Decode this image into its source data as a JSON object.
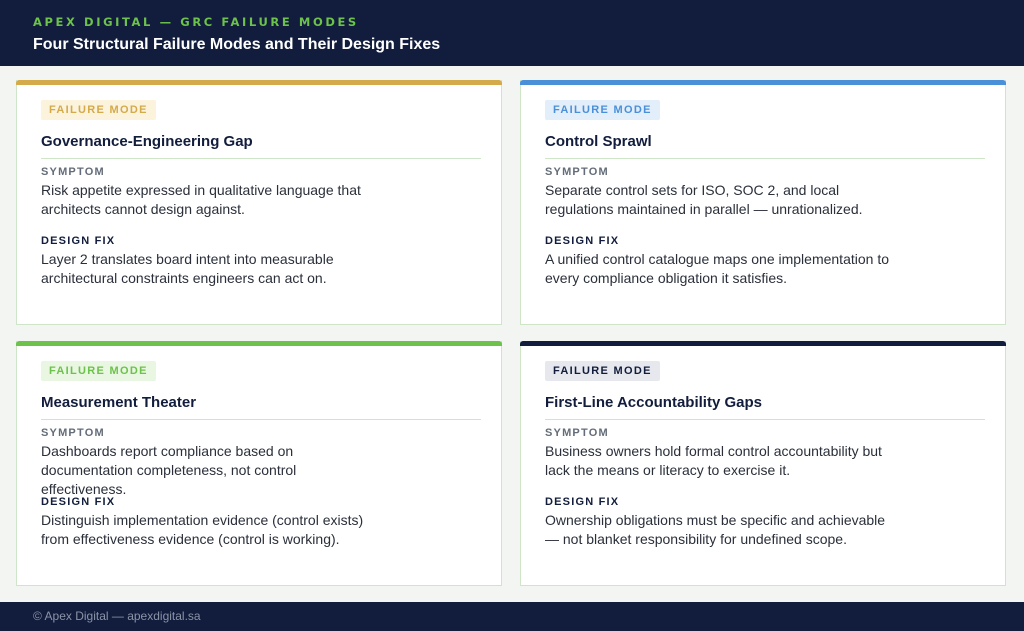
{
  "header": {
    "eyebrow": "APEX DIGITAL — GRC FAILURE MODES",
    "title": "Four Structural Failure Modes and Their Design Fixes"
  },
  "colors": {
    "gold": "#d4aa4a",
    "blue": "#4a90d9",
    "green": "#6cc24a",
    "navy": "#121d3d"
  },
  "cards": [
    {
      "tag": "FAILURE MODE",
      "title": "Governance-Engineering Gap",
      "symptom_label": "SYMPTOM",
      "symptom": "Risk appetite expressed in qualitative language that architects cannot design against.",
      "fix_label": "DESIGN FIX",
      "fix": "Layer 2 translates board intent into measurable architectural constraints engineers can act on."
    },
    {
      "tag": "FAILURE MODE",
      "title": "Control Sprawl",
      "symptom_label": "SYMPTOM",
      "symptom": "Separate control sets for ISO, SOC 2, and local regulations maintained in parallel — unrationalized.",
      "fix_label": "DESIGN FIX",
      "fix": "A unified control catalogue maps one implementation to every compliance obligation it satisfies."
    },
    {
      "tag": "FAILURE MODE",
      "title": "Measurement Theater",
      "symptom_label": "SYMPTOM",
      "symptom": "Dashboards report compliance based on documentation completeness, not control effectiveness.",
      "fix_label": "DESIGN FIX",
      "fix": "Distinguish implementation evidence (control exists) from effectiveness evidence (control is working)."
    },
    {
      "tag": "FAILURE MODE",
      "title": "First-Line Accountability Gaps",
      "symptom_label": "SYMPTOM",
      "symptom": "Business owners hold formal control accountability but lack the means or literacy to exercise it.",
      "fix_label": "DESIGN FIX",
      "fix": "Ownership obligations must be specific and achievable — not blanket responsibility for undefined scope."
    }
  ],
  "footer": {
    "text": "© Apex Digital — apexdigital.sa"
  }
}
